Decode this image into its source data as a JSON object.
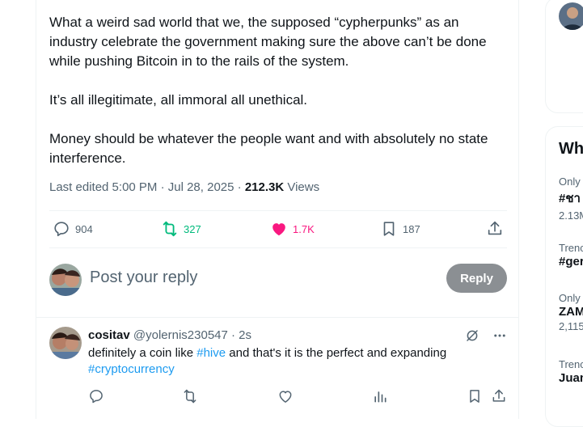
{
  "tweet": {
    "paragraphs": [
      "What a weird sad world that we, the supposed “cypherpunks” as an industry celebrate the government making sure the above can’t be done while pushing Bitcoin in to the rails of the system.",
      "It’s all illegitimate, all immoral all unethical.",
      "Money should be whatever the people want and with absolutely no state interference."
    ],
    "edited_label": "Last edited 5:00 PM · Jul 28, 2025 · ",
    "views_count": "212.3K",
    "views_label": " Views",
    "stats": {
      "replies": "904",
      "reposts": "327",
      "likes": "1.7K",
      "bookmarks": "187"
    }
  },
  "compose": {
    "placeholder": "Post your reply",
    "button_label": "Reply"
  },
  "reply": {
    "name": "cositav",
    "handle": "@yolernis230547",
    "time": "· 2s",
    "text_before": "definitely a coin like ",
    "hashtag1": "#hive",
    "text_after": " and that's it is the perfect and expanding",
    "hashtag2": "#cryptocurrency"
  },
  "sidebar": {
    "title": "Wh",
    "trends": [
      {
        "context": "Only",
        "name": "#ชา",
        "count": "2.13M"
      },
      {
        "context": "Trenc",
        "name": "#ger",
        "count": ""
      },
      {
        "context": "Only",
        "name": "ZAM",
        "count": "2,115"
      },
      {
        "context": "Trenc",
        "name": "Juan",
        "count": ""
      }
    ]
  },
  "colors": {
    "like": "#f91880",
    "repost": "#00ba7c",
    "link": "#1d9bf0",
    "reply_button": "#8b8f93"
  }
}
